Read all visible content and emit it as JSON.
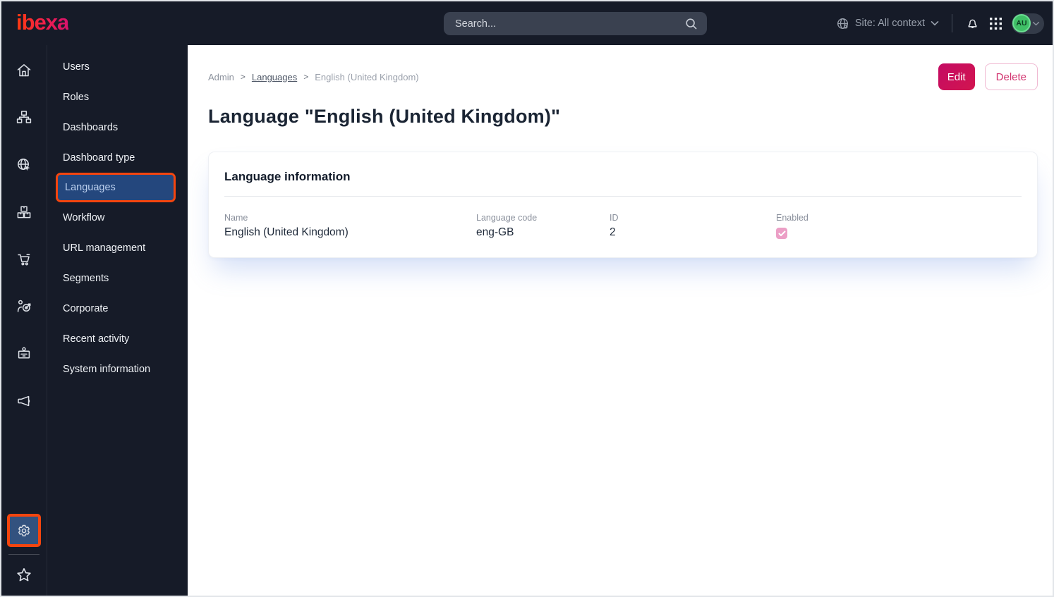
{
  "topbar": {
    "logo_text": "ibexa",
    "search_placeholder": "Search...",
    "site_context_label": "Site: All context",
    "avatar_initials": "AU"
  },
  "icon_rail": {
    "items": [
      {
        "icon": "home-icon"
      },
      {
        "icon": "content-structure-icon"
      },
      {
        "icon": "site-globe-cursor-icon"
      },
      {
        "icon": "product-catalog-boxes-icon"
      },
      {
        "icon": "commerce-cart-icon"
      },
      {
        "icon": "personalization-target-icon"
      },
      {
        "icon": "corporate-badge-icon"
      },
      {
        "icon": "marketing-megaphone-icon"
      }
    ],
    "bottom_items": [
      {
        "icon": "admin-gear-icon",
        "active": true
      },
      {
        "icon": "bookmarks-star-icon"
      }
    ]
  },
  "sidebar": {
    "items": [
      {
        "label": "Users"
      },
      {
        "label": "Roles"
      },
      {
        "label": "Dashboards"
      },
      {
        "label": "Dashboard type"
      },
      {
        "label": "Languages",
        "active": true
      },
      {
        "label": "Workflow"
      },
      {
        "label": "URL management"
      },
      {
        "label": "Segments"
      },
      {
        "label": "Corporate"
      },
      {
        "label": "Recent activity"
      },
      {
        "label": "System information"
      }
    ]
  },
  "breadcrumb": {
    "items": [
      {
        "label": "Admin"
      },
      {
        "label": "Languages",
        "link": true
      },
      {
        "label": "English (United Kingdom)",
        "current": true
      }
    ],
    "separator": ">"
  },
  "actions": {
    "edit_label": "Edit",
    "delete_label": "Delete"
  },
  "page": {
    "title": "Language \"English (United Kingdom)\""
  },
  "card": {
    "title": "Language information",
    "fields": [
      {
        "label": "Name",
        "value": "English (United Kingdom)"
      },
      {
        "label": "Language code",
        "value": "eng-GB"
      },
      {
        "label": "ID",
        "value": "2"
      },
      {
        "label": "Enabled",
        "type": "checkbox",
        "checked": true
      }
    ]
  },
  "colors": {
    "topbar_bg": "#161b28",
    "accent_orange": "#f4450e",
    "selected_blue": "#24477d",
    "primary_magenta": "#c40b63",
    "checkbox_pink": "#ec9fc6",
    "avatar_green": "#3fbf66"
  }
}
